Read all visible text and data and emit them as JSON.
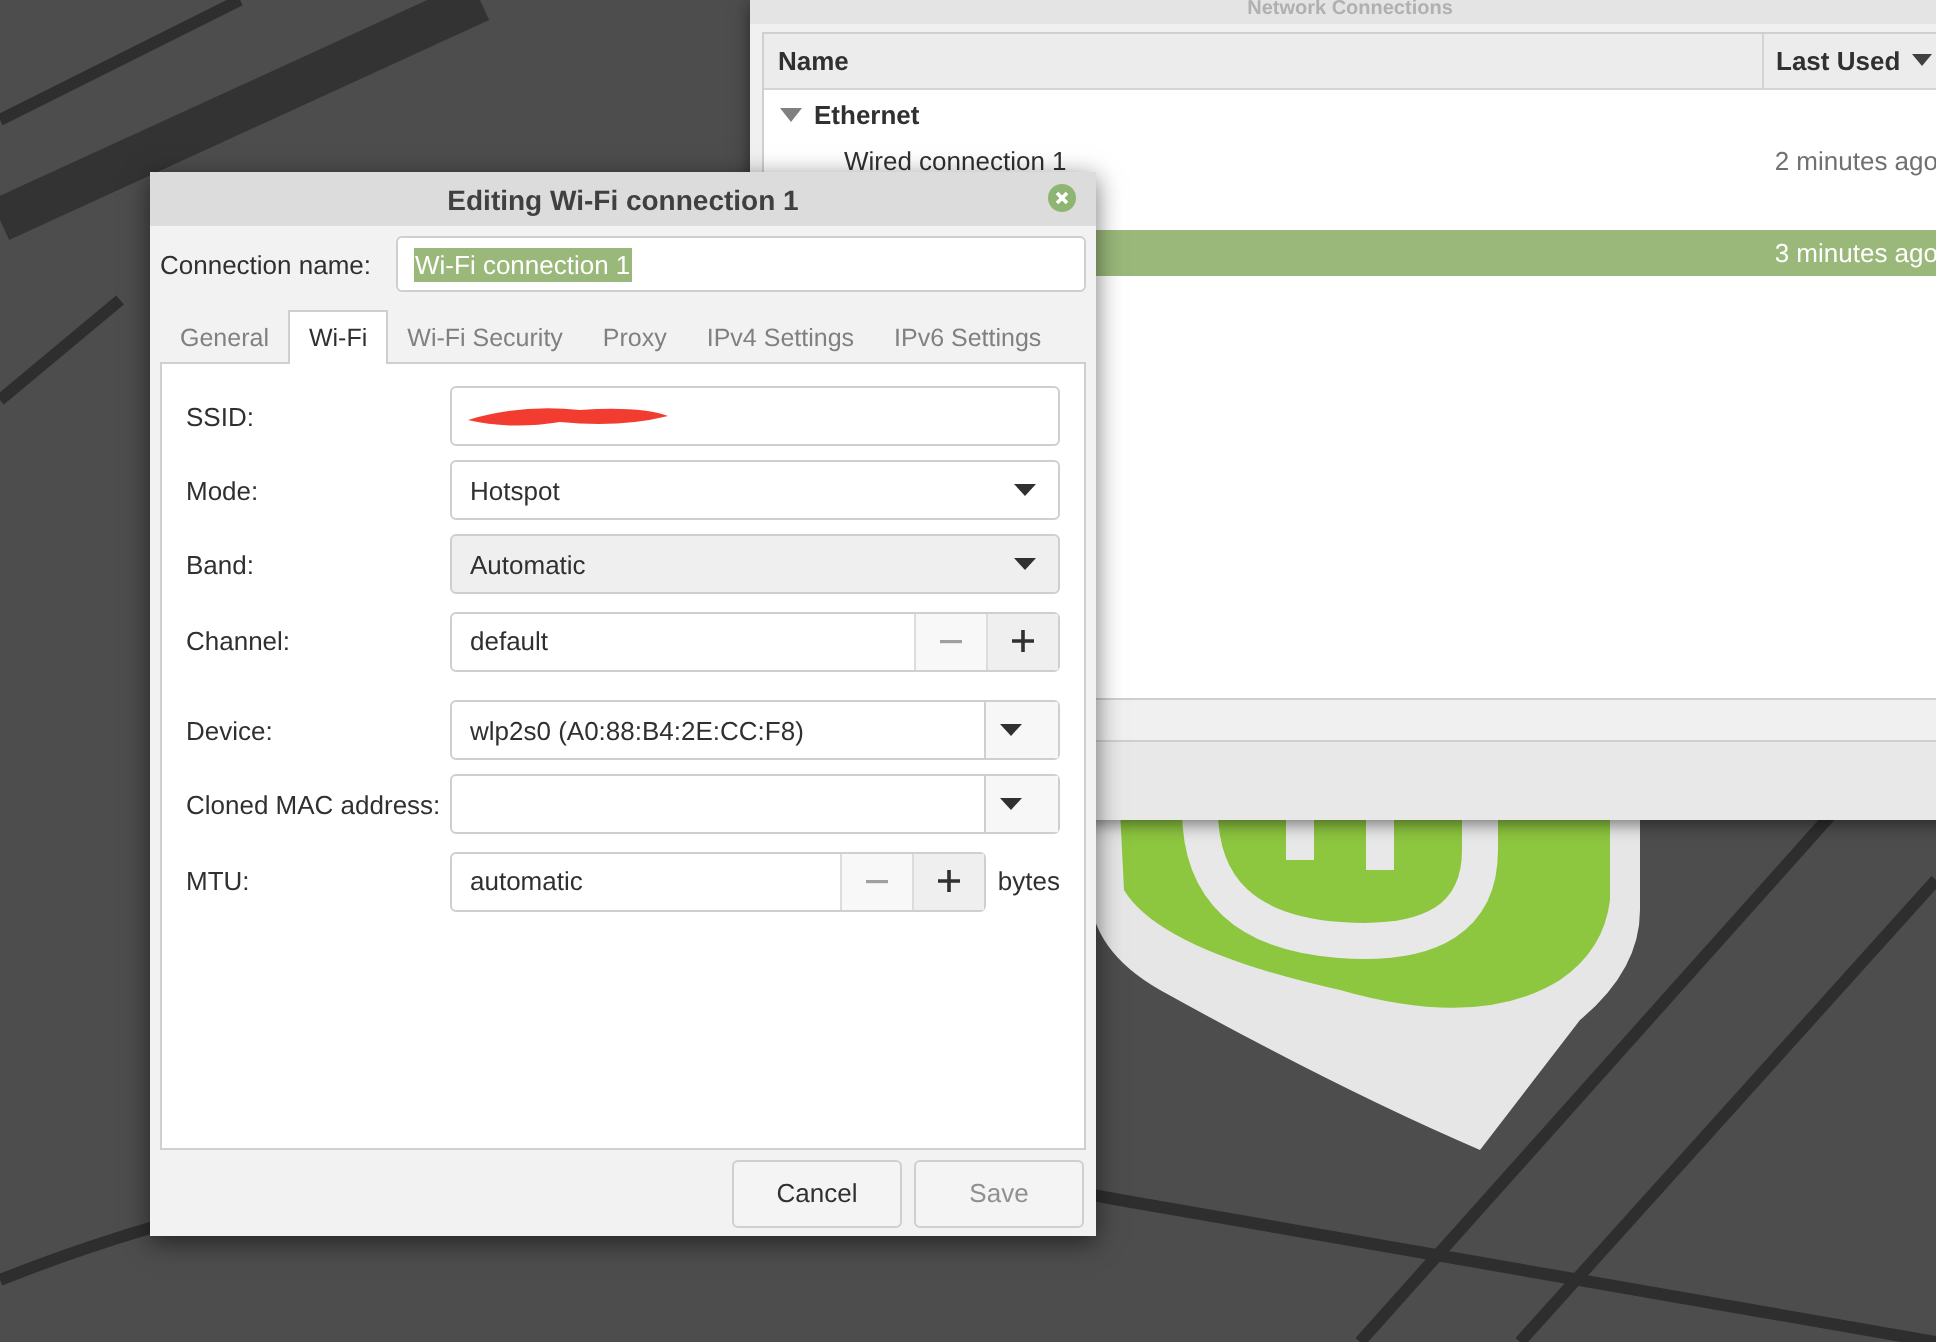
{
  "connections_window": {
    "title": "Network Connections",
    "columns": [
      "Name",
      "Last Used"
    ],
    "rows": [
      {
        "kind": "group",
        "name": "Ethernet",
        "expanded": true
      },
      {
        "kind": "item",
        "name": "Wired connection 1",
        "last_used": "2 minutes ago",
        "selected": false
      },
      {
        "kind": "group"
      },
      {
        "kind": "item",
        "last_used": "3 minutes ago",
        "selected": true
      }
    ]
  },
  "dialog": {
    "title": "Editing Wi-Fi connection 1",
    "connection_name_label": "Connection name:",
    "connection_name": "Wi-Fi connection 1",
    "tabs": [
      {
        "label": "General",
        "selected": false
      },
      {
        "label": "Wi-Fi",
        "selected": true
      },
      {
        "label": "Wi-Fi Security",
        "selected": false
      },
      {
        "label": "Proxy",
        "selected": false
      },
      {
        "label": "IPv4 Settings",
        "selected": false
      },
      {
        "label": "IPv6 Settings",
        "selected": false
      }
    ],
    "fields": [
      {
        "kind": "redacted",
        "label": "SSID:"
      },
      {
        "kind": "select",
        "label": "Mode:",
        "value": "Hotspot",
        "hover": false
      },
      {
        "kind": "select",
        "label": "Band:",
        "value": "Automatic",
        "hover": true
      },
      {
        "kind": "spin",
        "label": "Channel:",
        "value": "default",
        "minus_disabled": true
      },
      {
        "kind": "combo",
        "label": "Device:",
        "value": "wlp2s0 (A0:88:B4:2E:CC:F8)"
      },
      {
        "kind": "combo",
        "label": "Cloned MAC address:"
      },
      {
        "kind": "spin",
        "label": "MTU:",
        "value": "automatic",
        "minus_disabled": true,
        "unit": "bytes"
      }
    ],
    "buttons": [
      {
        "label": "Cancel",
        "disabled": false
      },
      {
        "label": "Save",
        "disabled": true
      }
    ]
  }
}
